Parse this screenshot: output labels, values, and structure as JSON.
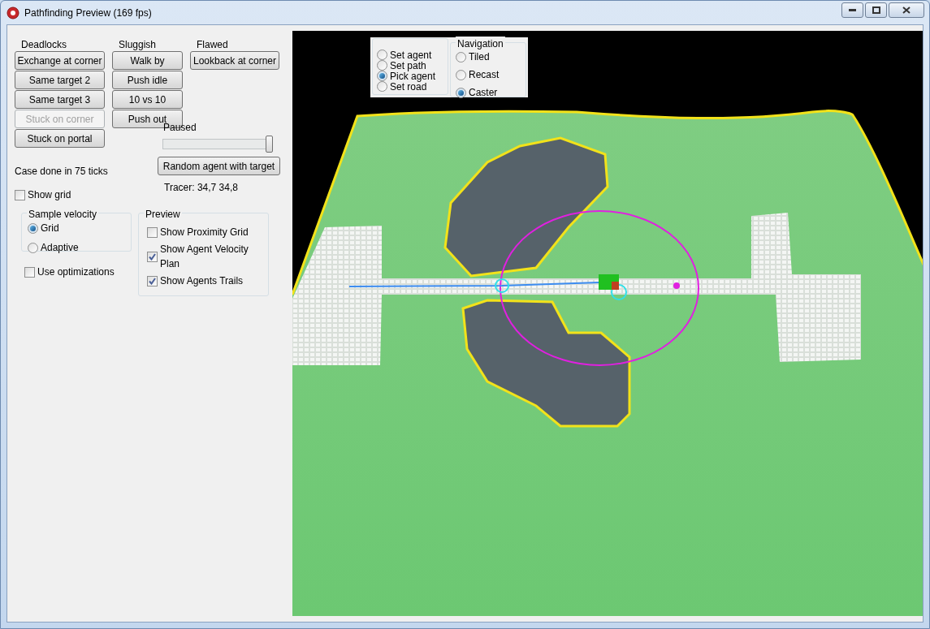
{
  "window": {
    "title": "Pathfinding Preview (169 fps)"
  },
  "groups": [
    {
      "heading": "Deadlocks",
      "buttons": [
        {
          "label": "Exchange at corner",
          "disabled": false
        },
        {
          "label": "Same target 2",
          "disabled": false
        },
        {
          "label": "Same target 3",
          "disabled": false
        },
        {
          "label": "Stuck on corner",
          "disabled": true
        },
        {
          "label": "Stuck on portal",
          "disabled": false
        }
      ]
    },
    {
      "heading": "Sluggish",
      "buttons": [
        {
          "label": "Walk by",
          "disabled": false
        },
        {
          "label": "Push idle",
          "disabled": false
        },
        {
          "label": "10 vs 10",
          "disabled": false
        },
        {
          "label": "Push out",
          "disabled": false
        }
      ]
    },
    {
      "heading": "Flawed",
      "buttons": [
        {
          "label": "Lookback at corner",
          "disabled": false
        }
      ]
    }
  ],
  "speed": {
    "label": "Paused",
    "level": 1.0
  },
  "status": "Case done in 75 ticks",
  "random_button": "Random agent with target",
  "show_grid": {
    "label": "Show grid",
    "checked": false
  },
  "tracer": "Tracer: 34,7 34,8",
  "sample_velocity": {
    "title": "Sample velocity",
    "options": [
      {
        "label": "Grid",
        "selected": true
      },
      {
        "label": "Adaptive",
        "selected": false
      }
    ]
  },
  "use_optimizations": {
    "label": "Use optimizations",
    "checked": false
  },
  "preview": {
    "title": "Preview",
    "options": [
      {
        "label": "Show Proximity Grid",
        "checked": false
      },
      {
        "label": "Show Agent Velocity Plan",
        "checked": true
      },
      {
        "label": "Show Agents Trails",
        "checked": true
      }
    ]
  },
  "viewport": {
    "tool_options": [
      {
        "label": "Set agent",
        "selected": false
      },
      {
        "label": "Set path",
        "selected": false
      },
      {
        "label": "Pick agent",
        "selected": true
      },
      {
        "label": "Set road",
        "selected": false
      }
    ],
    "navigation": {
      "title": "Navigation",
      "options": [
        {
          "label": "Tiled",
          "selected": false
        },
        {
          "label": "Recast",
          "selected": false
        },
        {
          "label": "Caster",
          "selected": true
        }
      ]
    }
  }
}
